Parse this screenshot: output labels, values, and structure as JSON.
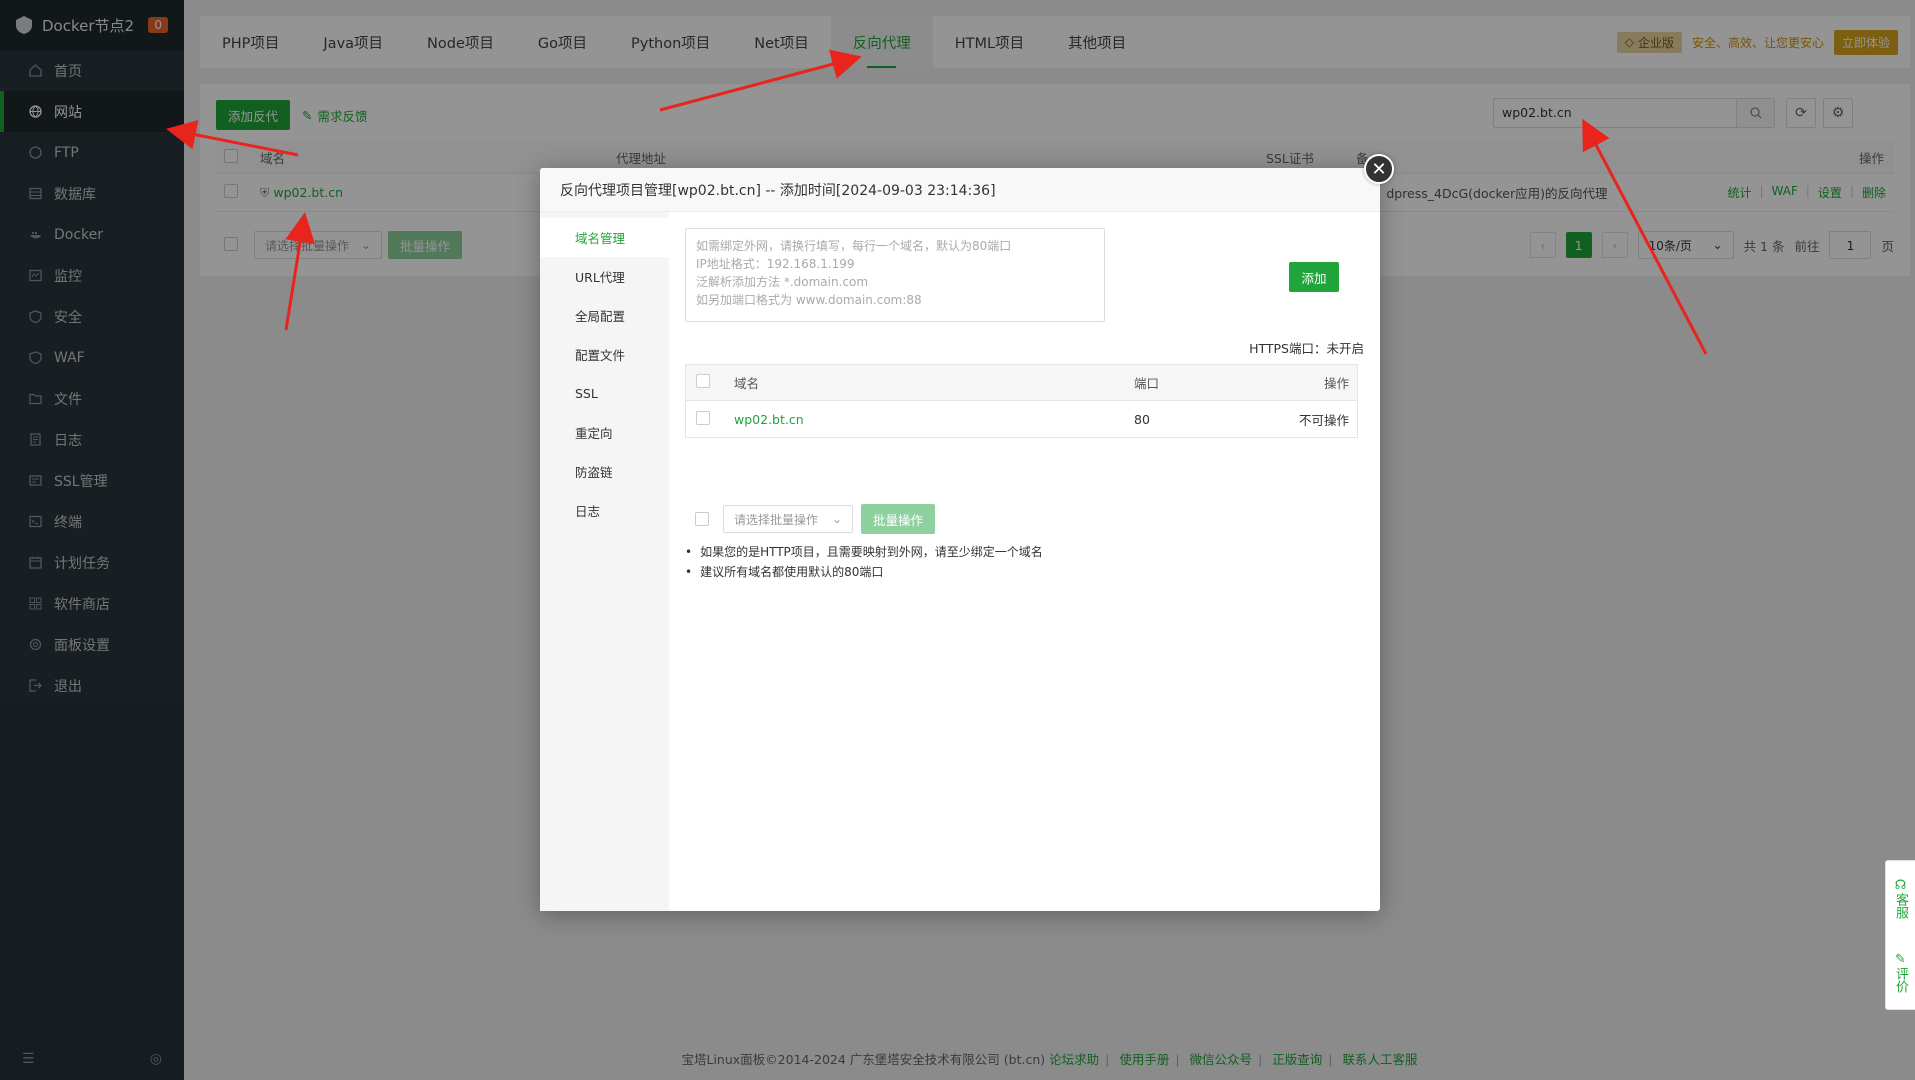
{
  "sidebar": {
    "title": "Docker节点2",
    "badge": "0",
    "items": [
      {
        "label": "首页",
        "icon": "home-icon"
      },
      {
        "label": "网站",
        "icon": "globe-icon",
        "active": true
      },
      {
        "label": "FTP",
        "icon": "ftp-icon"
      },
      {
        "label": "数据库",
        "icon": "database-icon"
      },
      {
        "label": "Docker",
        "icon": "docker-icon"
      },
      {
        "label": "监控",
        "icon": "monitor-icon"
      },
      {
        "label": "安全",
        "icon": "shield-icon"
      },
      {
        "label": "WAF",
        "icon": "waf-icon"
      },
      {
        "label": "文件",
        "icon": "folder-icon"
      },
      {
        "label": "日志",
        "icon": "log-icon"
      },
      {
        "label": "SSL管理",
        "icon": "ssl-icon"
      },
      {
        "label": "终端",
        "icon": "terminal-icon"
      },
      {
        "label": "计划任务",
        "icon": "calendar-icon"
      },
      {
        "label": "软件商店",
        "icon": "store-icon"
      },
      {
        "label": "面板设置",
        "icon": "gear-icon"
      },
      {
        "label": "退出",
        "icon": "logout-icon"
      }
    ]
  },
  "tabs": [
    "PHP项目",
    "Java项目",
    "Node项目",
    "Go项目",
    "Python项目",
    "Net项目",
    "反向代理",
    "HTML项目",
    "其他项目"
  ],
  "promo": {
    "tag": "企业版",
    "slogan": "安全、高效、让您更安心",
    "button": "立即体验"
  },
  "toolbar": {
    "add_label": "添加反代",
    "feedback_label": "需求反馈",
    "search_value": "wp02.bt.cn"
  },
  "table": {
    "headers": {
      "domain": "域名",
      "proxy": "代理地址",
      "ssl": "SSL证书",
      "remark": "备",
      "ops": "操作"
    },
    "row": {
      "domain": "wp02.bt.cn",
      "remark": "dpress_4DcG(docker应用)的反向代理"
    },
    "ops": [
      "统计",
      "WAF",
      "设置",
      "删除"
    ]
  },
  "bottom": {
    "select_placeholder": "请选择批量操作",
    "batch_label": "批量操作",
    "page": "1",
    "page_size": "10条/页",
    "total": "共 1 条",
    "goto": "前往",
    "goto_value": "1",
    "page_unit": "页"
  },
  "footer": {
    "copyright": "宝塔Linux面板©2014-2024 广东堡塔安全技术有限公司 (bt.cn)",
    "links": [
      "论坛求助",
      "使用手册",
      "微信公众号",
      "正版查询",
      "联系人工客服"
    ]
  },
  "float": {
    "service": "客服",
    "review": "评价"
  },
  "modal": {
    "title": "反向代理项目管理[wp02.bt.cn] -- 添加时间[2024-09-03 23:14:36]",
    "nav": [
      "域名管理",
      "URL代理",
      "全局配置",
      "配置文件",
      "SSL",
      "重定向",
      "防盗链",
      "日志"
    ],
    "placeholder_lines": [
      "如需绑定外网，请换行填写，每行一个域名，默认为80端口",
      "IP地址格式：192.168.1.199",
      "泛解析添加方法 *.domain.com",
      "如另加端口格式为 www.domain.com:88"
    ],
    "add_label": "添加",
    "https_status": "HTTPS端口：未开启",
    "headers": {
      "domain": "域名",
      "port": "端口",
      "ops": "操作"
    },
    "row": {
      "domain": "wp02.bt.cn",
      "port": "80",
      "ops": "不可操作"
    },
    "batch_placeholder": "请选择批量操作",
    "batch_label": "批量操作",
    "tips": [
      "如果您的是HTTP项目，且需要映射到外网，请至少绑定一个域名",
      "建议所有域名都使用默认的80端口"
    ]
  },
  "colors": {
    "accent": "#20a53a",
    "sidebar_bg": "#263238",
    "arrow": "#e8241c"
  }
}
